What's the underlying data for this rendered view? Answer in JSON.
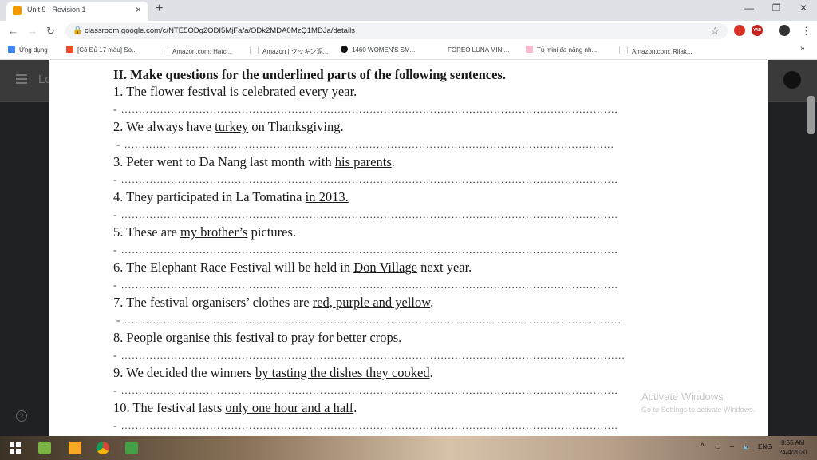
{
  "browser": {
    "tab_title": "Unit 9 - Revision 1",
    "new_tab": "+",
    "close_tab": "×",
    "url": "classroom.google.com/c/NTE5ODg2ODI5MjFa/a/ODk2MDA0MzQ1MDJa/details",
    "bookmarks": [
      {
        "label": "Ứng dụng",
        "icon": "apps-icon",
        "color": "#4285f4"
      },
      {
        "label": "[Có Đủ 17 màu] So...",
        "icon": "shopee-icon",
        "color": "#ee4d2d"
      },
      {
        "label": "Amazon.com: Hatc...",
        "icon": "amazon-icon",
        "color": "#222222"
      },
      {
        "label": "Amazon | クッキン泥...",
        "icon": "amazon-icon",
        "color": "#222222"
      },
      {
        "label": "1460 WOMEN'S SM...",
        "icon": "plus-circle-icon",
        "color": "#111111"
      },
      {
        "label": "FOREO LUNA MINI...",
        "icon": "page-icon",
        "color": "#ffffff"
      },
      {
        "label": "Tủ mini đa năng nh...",
        "icon": "image-icon",
        "color": "#f8bbd0"
      },
      {
        "label": "Amazon.com: Rilak...",
        "icon": "amazon-icon",
        "color": "#222222"
      }
    ],
    "bookmarks_overflow": "»"
  },
  "document": {
    "heading": "II. Make questions for the underlined parts of the following sentences.",
    "answer_dash": "-",
    "questions": [
      {
        "pre": "1. The flower festival is celebrated ",
        "ul": "every year",
        "post": "."
      },
      {
        "pre": "2. We always have ",
        "ul": "turkey",
        "post": " on Thanksgiving."
      },
      {
        "pre": "3. Peter went to Da Nang last month with ",
        "ul": "his parents",
        "post": "."
      },
      {
        "pre": "4. They participated in La Tomatina ",
        "ul": "in 2013.",
        "post": ""
      },
      {
        "pre": "5.  These are ",
        "ul": "my brother’s",
        "post": " pictures."
      },
      {
        "pre": "6. The Elephant Race Festival will be held in ",
        "ul": "Don Village",
        "post": " next year."
      },
      {
        "pre": "7. The festival organisers’ clothes are ",
        "ul": "red, purple and yellow",
        "post": "."
      },
      {
        "pre": "8. People organise this festival ",
        "ul": "to pray for better crops",
        "post": "."
      },
      {
        "pre": "9. We decided the winners ",
        "ul": "by tasting the dishes they cooked",
        "post": "."
      },
      {
        "pre": "10. The festival lasts ",
        "ul": "only one hour and a half",
        "post": "."
      }
    ]
  },
  "watermark": {
    "title": "Activate Windows",
    "subtitle": "Go to Settings to activate Windows."
  },
  "taskbar": {
    "language": "ENG",
    "time": "8:55 AM",
    "date": "24/4/2020",
    "tray_expand": "^"
  },
  "colors": {
    "tabstrip": "#dee1e6",
    "page_dark": "#202124",
    "classroom_bar": "#3a3a3a"
  }
}
